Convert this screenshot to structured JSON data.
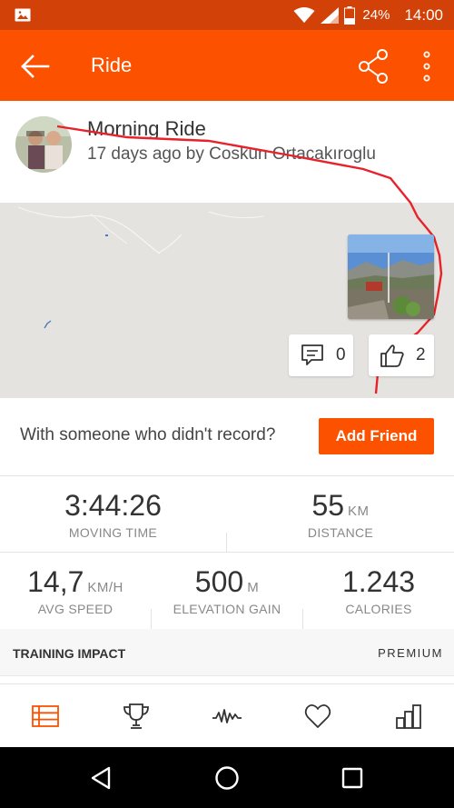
{
  "status_bar": {
    "battery": "24%",
    "time": "14:00"
  },
  "app_bar": {
    "title": "Ride"
  },
  "activity": {
    "name": "Morning Ride",
    "meta": "17 days ago by Coskun Ortacakıroglu"
  },
  "map": {
    "comment_count": "0",
    "kudos_count": "2"
  },
  "friend": {
    "prompt": "With someone who didn't record?",
    "button_label": "Add Friend"
  },
  "stats": {
    "moving_time": {
      "value": "3:44:26",
      "label": "MOVING TIME"
    },
    "distance": {
      "value": "55",
      "unit": "KM",
      "label": "DISTANCE"
    },
    "avg_speed": {
      "value": "14,7",
      "unit": "KM/H",
      "label": "AVG SPEED"
    },
    "elevation": {
      "value": "500",
      "unit": "M",
      "label": "ELEVATION GAIN"
    },
    "calories": {
      "value": "1.243",
      "label": "CALORIES"
    }
  },
  "training": {
    "title": "TRAINING IMPACT",
    "badge": "PREMIUM"
  },
  "bottom_nav": [
    "feed-icon",
    "trophy-icon",
    "activity-wave-icon",
    "heart-icon",
    "stats-bars-icon"
  ],
  "colors": {
    "brand": "#fc5200",
    "status_bar": "#d14108",
    "route": "#e8222a"
  }
}
